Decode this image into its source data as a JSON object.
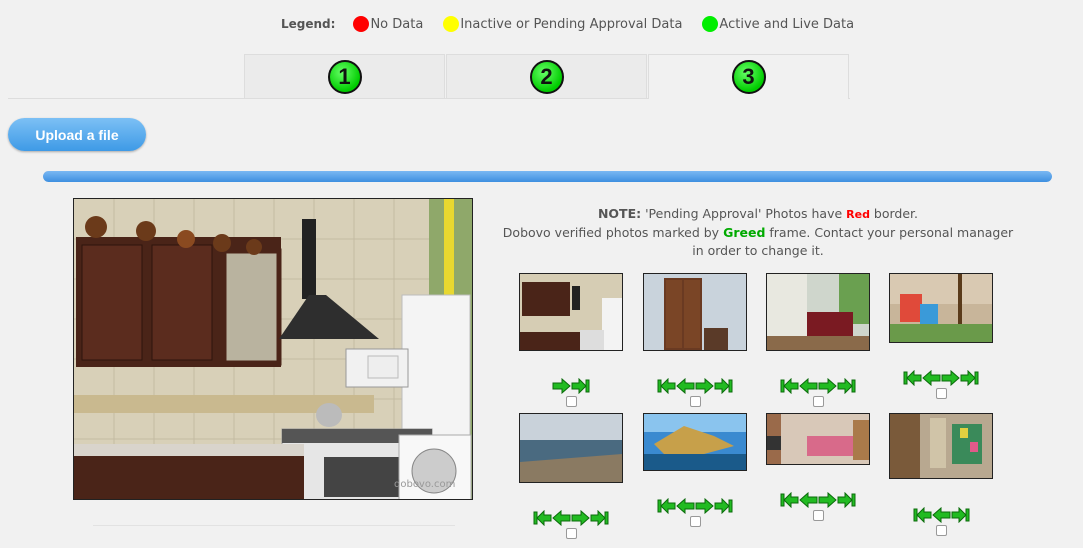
{
  "legend": {
    "label": "Legend:",
    "items": [
      {
        "color": "#ff0000",
        "text": "No Data"
      },
      {
        "color": "#ffff00",
        "text": "Inactive or Pending Approval Data"
      },
      {
        "color": "#00ee00",
        "text": "Active and Live Data"
      }
    ]
  },
  "tabs": [
    {
      "label": "1",
      "active": false
    },
    {
      "label": "2",
      "active": false
    },
    {
      "label": "3",
      "active": true
    }
  ],
  "upload": {
    "label": "Upload a file"
  },
  "progress": {
    "percent": 100
  },
  "note": {
    "prefix": "NOTE:",
    "line1a": " 'Pending Approval' Photos have ",
    "red_word": "Red",
    "line1b": " border.",
    "line2a": "Dobovo verified photos marked by ",
    "green_word": "Greed",
    "line2b": " frame. Contact your personal manager in order to change it."
  },
  "watermark": "dobovo.com",
  "thumbnails": [
    {
      "scene": "kitchen",
      "arrows": [
        "right",
        "last"
      ]
    },
    {
      "scene": "wardrobe",
      "arrows": [
        "first",
        "left",
        "right",
        "last"
      ]
    },
    {
      "scene": "livingroom",
      "arrows": [
        "first",
        "left",
        "right",
        "last"
      ]
    },
    {
      "scene": "playground",
      "arrows": [
        "first",
        "left",
        "right",
        "last"
      ]
    },
    {
      "scene": "coast",
      "arrows": [
        "first",
        "left",
        "right",
        "last"
      ]
    },
    {
      "scene": "rocks",
      "arrows": [
        "first",
        "left",
        "right",
        "last"
      ]
    },
    {
      "scene": "bedroom",
      "arrows": [
        "first",
        "left",
        "right",
        "last"
      ]
    },
    {
      "scene": "hallway",
      "arrows": [
        "first",
        "left",
        "last"
      ]
    }
  ]
}
